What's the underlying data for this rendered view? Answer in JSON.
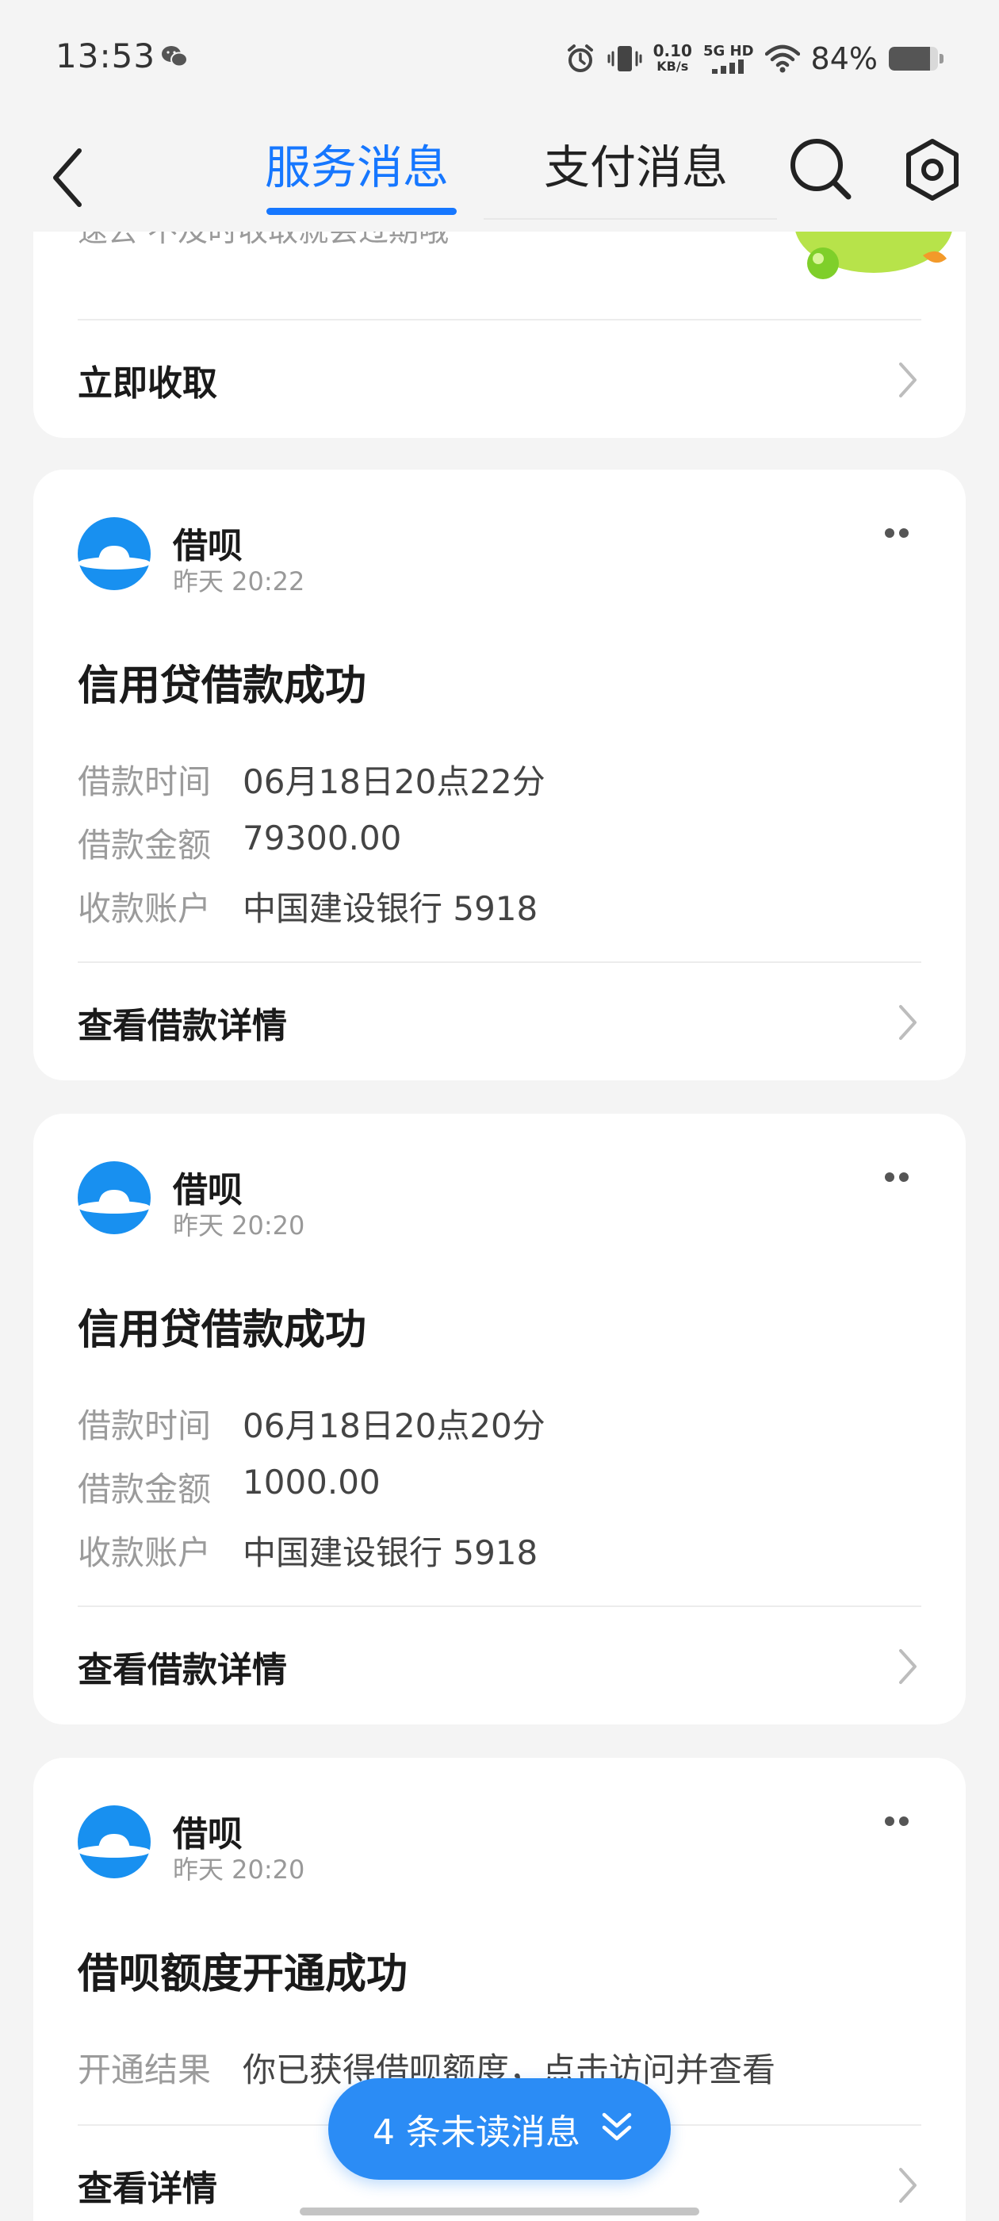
{
  "status_bar": {
    "time": "13:53",
    "net_speed_value": "0.10",
    "net_speed_unit": "KB/s",
    "network_type": "5G HD",
    "battery_text": "84%",
    "battery_level": 0.84,
    "icons": [
      "wechat-icon",
      "alarm-icon",
      "vibrate-icon",
      "signal-icon",
      "wifi-icon",
      "battery-icon"
    ]
  },
  "header": {
    "tabs": [
      {
        "label": "服务消息",
        "active": true
      },
      {
        "label": "支付消息",
        "active": false
      }
    ],
    "icons": [
      "back-icon",
      "search-icon",
      "settings-icon"
    ],
    "accent_color": "#1677ff"
  },
  "top_card": {
    "cut_text": "速去 不及时收取就会过期哦",
    "action_label": "立即收取"
  },
  "messages": [
    {
      "sender": "借呗",
      "time": "昨天 20:22",
      "title": "信用贷借款成功",
      "fields": [
        {
          "label": "借款时间",
          "value": "06月18日20点22分"
        },
        {
          "label": "借款金额",
          "value": "79300.00"
        },
        {
          "label": "收款账户",
          "value": "中国建设银行 5918"
        }
      ],
      "action_label": "查看借款详情"
    },
    {
      "sender": "借呗",
      "time": "昨天 20:20",
      "title": "信用贷借款成功",
      "fields": [
        {
          "label": "借款时间",
          "value": "06月18日20点20分"
        },
        {
          "label": "借款金额",
          "value": "1000.00"
        },
        {
          "label": "收款账户",
          "value": "中国建设银行 5918"
        }
      ],
      "action_label": "查看借款详情"
    },
    {
      "sender": "借呗",
      "time": "昨天 20:20",
      "title": "借呗额度开通成功",
      "fields": [
        {
          "label": "开通结果",
          "value": "你已获得借呗额度，点击访问并查看"
        }
      ],
      "action_label": "查看详情"
    }
  ],
  "unread_pill": {
    "label": "4 条未读消息",
    "color": "#2b8cf5"
  }
}
